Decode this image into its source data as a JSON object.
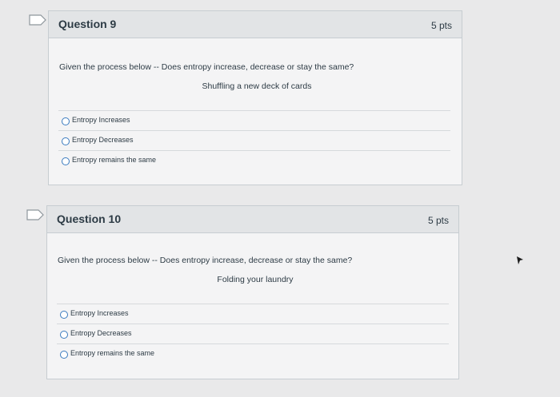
{
  "questions": [
    {
      "title": "Question 9",
      "points": "5 pts",
      "prompt": "Given the process below -- Does entropy increase, decrease or stay the same?",
      "process": "Shuffling a new deck of cards",
      "options": [
        "Entropy Increases",
        "Entropy Decreases",
        "Entropy remains the same"
      ]
    },
    {
      "title": "Question 10",
      "points": "5 pts",
      "prompt": "Given the process below -- Does entropy increase, decrease or stay the same?",
      "process": "Folding your laundry",
      "options": [
        "Entropy Increases",
        "Entropy Decreases",
        "Entropy remains the same"
      ]
    }
  ],
  "icons": {
    "flag": "flag-icon",
    "radio": "radio-button-icon",
    "cursor": "mouse-pointer-icon"
  },
  "colors": {
    "radio_border": "#3b7bbf",
    "header_bg": "#e2e4e6",
    "card_bg": "#f4f4f5"
  }
}
